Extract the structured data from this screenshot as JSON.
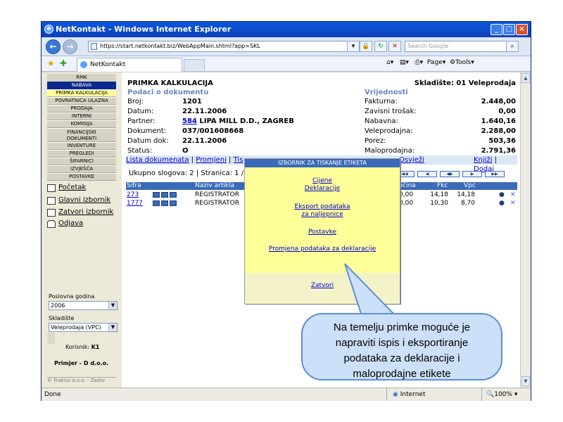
{
  "window": {
    "title": "NetKontakt - Windows Internet Explorer"
  },
  "browser": {
    "url": "https://start.netkontakt.biz/WebAppMain.shtml?app=SKL",
    "search_placeholder": "Search Google",
    "tab_label": "NetKontakt",
    "page_menu": "Page",
    "tools_menu": "Tools",
    "status_left": "Done",
    "status_zone": "Internet",
    "zoom": "100%"
  },
  "sidebar": {
    "header": "RMK",
    "subheader": "NABAVA",
    "items": [
      "PRIMKA KALKULACIJA",
      "POVRATNICA ULAZNA",
      "PRODAJA",
      "INTERNI",
      "KOMISIJA",
      "FINANCIJSKI DOKUMENTI",
      "INVENTURE",
      "PREGLEDI",
      "ŠIFARNICI",
      "IZVJEŠĆA",
      "POSTAVKE"
    ],
    "links": [
      "Početak",
      "Glavni izbornik",
      "Zatvori izbornik",
      "Odjava"
    ],
    "year_label": "Poslovna godina",
    "year_value": "2006",
    "warehouse_label": "Skladište",
    "warehouse_value": "Veleprodaja (VPC)",
    "user_label": "Korisnik:",
    "user_value": "K1",
    "company": "Primjer - D d.o.o.",
    "copyright": "© Fraktal d.o.o. - Zadar"
  },
  "doc": {
    "title": "PRIMKA KALKULACIJA",
    "warehouse": "Skladište: 01 Veleprodaja",
    "section_left": "Podaci o dokumentu",
    "section_right": "Vrijednosti",
    "fields": [
      {
        "label": "Broj:",
        "value": "1201"
      },
      {
        "label": "Datum:",
        "value": "22.11.2006"
      },
      {
        "label": "Partner:",
        "value": "LIPA MILL D.D., ZAGREB",
        "link": "584"
      },
      {
        "label": "Dokument:",
        "value": "037/001608668"
      },
      {
        "label": "Datum dok:",
        "value": "22.11.2006"
      },
      {
        "label": "Status:",
        "value": "O"
      }
    ],
    "values": [
      {
        "label": "Fakturna:",
        "value": "2.448,00"
      },
      {
        "label": "Zavisni trošak:",
        "value": "0,00"
      },
      {
        "label": "Nabavna:",
        "value": "1.640,16"
      },
      {
        "label": "Veleprodajna:",
        "value": "2.288,00"
      },
      {
        "label": "Porez:",
        "value": "503,36"
      },
      {
        "label": "Maloprodajna:",
        "value": "2.791,36"
      }
    ],
    "links_left": [
      "Lista dokumenata",
      "Promjeni",
      "Tis"
    ],
    "links_right": [
      "Osvježi",
      "Knjiži",
      "Dodaj"
    ],
    "paging": "Ukupno slogova: 2 | Stranica: 1 /",
    "table_headers": [
      "Šifra",
      "Naziv artikla",
      "ličina",
      "Fkc",
      "Vpc"
    ],
    "rows": [
      {
        "code": "273",
        "name": "REGISTRATOR",
        "qty": "0,00",
        "fkc": "14,18",
        "vpc": "14,18"
      },
      {
        "code": "1777",
        "name": "REGISTRATOR",
        "qty": "0,00",
        "fkc": "10,30",
        "vpc": "8,70"
      }
    ]
  },
  "popup": {
    "title": "IZBORNIK ZA TISKANJE ETIKETA",
    "link1a": "Cijene",
    "link1b": "Deklaracije",
    "link2a": "Eksport podataka",
    "link2b": "za naljepnice",
    "link3": "Postavke",
    "link4": "Promjena podataka za deklaracije",
    "close": "Zatvori"
  },
  "callout": {
    "line1": "Na temelju primke moguće je",
    "line2": "napraviti ispis i eksportiranje",
    "line3": "podataka za deklaracije i",
    "line4": "maloprodajne etikete"
  }
}
